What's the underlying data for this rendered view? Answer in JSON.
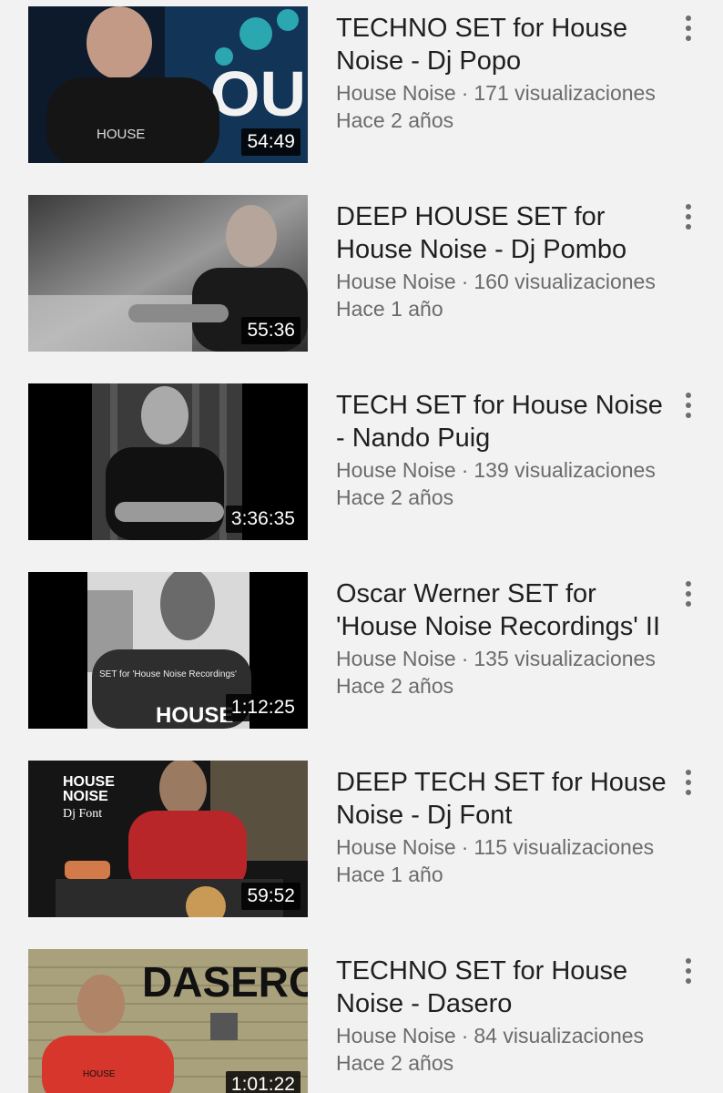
{
  "videos": [
    {
      "title": "TECHNO SET for House Noise - Dj Popo",
      "channel": "House Noise",
      "views": "171 visualizaciones",
      "age": "Hace 2 años",
      "duration": "54:49"
    },
    {
      "title": "DEEP HOUSE SET for House Noise - Dj Pombo",
      "channel": "House Noise",
      "views": "160 visualizaciones",
      "age": "Hace 1 año",
      "duration": "55:36"
    },
    {
      "title": "TECH SET for House Noise - Nando Puig",
      "channel": "House Noise",
      "views": "139 visualizaciones",
      "age": "Hace 2 años",
      "duration": "3:36:35"
    },
    {
      "title": "Oscar Werner SET for 'House Noise Recordings' II",
      "channel": "House Noise",
      "views": "135 visualizaciones",
      "age": "Hace 2 años",
      "duration": "1:12:25"
    },
    {
      "title": "DEEP TECH SET for House Noise - Dj Font",
      "channel": "House Noise",
      "views": "115 visualizaciones",
      "age": "Hace 1 año",
      "duration": "59:52"
    },
    {
      "title": "TECHNO SET for House Noise - Dasero",
      "channel": "House Noise",
      "views": "84 visualizaciones",
      "age": "Hace 2 años",
      "duration": "1:01:22"
    }
  ],
  "separator": "·",
  "thumb_text": {
    "shirt_logo": "HOUSE",
    "house_noise_top": "HOUSE",
    "house_noise_bottom": "NOISE",
    "dj_font": "Dj Font",
    "dasero": "DASERO",
    "oscar_caption": "SET for 'House Noise Recordings'"
  },
  "icons": {
    "menu": "vertical-dots-icon"
  }
}
